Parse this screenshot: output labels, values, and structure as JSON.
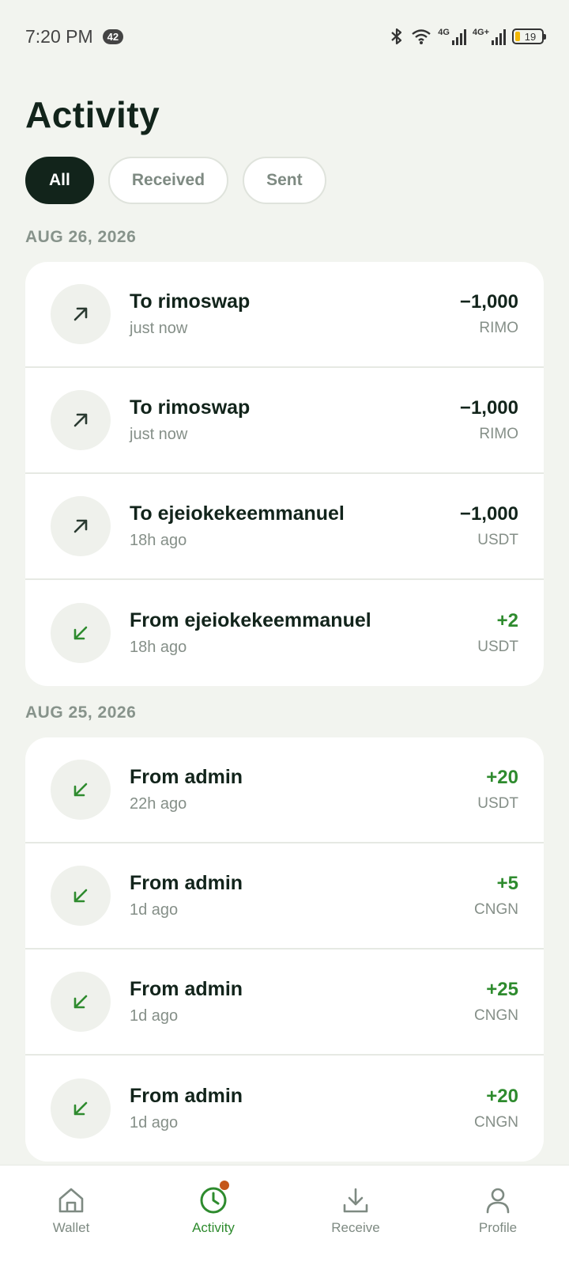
{
  "status_bar": {
    "time": "7:20 PM",
    "notification_count": "42",
    "network1": "4G",
    "network2": "4G+",
    "battery": "19"
  },
  "page": {
    "title": "Activity"
  },
  "filters": [
    {
      "label": "All",
      "active": true
    },
    {
      "label": "Received",
      "active": false
    },
    {
      "label": "Sent",
      "active": false
    }
  ],
  "groups": [
    {
      "date": "AUG 26, 2026",
      "items": [
        {
          "direction": "sent",
          "icon": "arrow-up-right-icon",
          "title": "To rimoswap",
          "time": "just now",
          "amount": "−1,000",
          "currency": "RIMO"
        },
        {
          "direction": "sent",
          "icon": "arrow-up-right-icon",
          "title": "To rimoswap",
          "time": "just now",
          "amount": "−1,000",
          "currency": "RIMO"
        },
        {
          "direction": "sent",
          "icon": "arrow-up-right-icon",
          "title": "To ejeiokekeemmanuel",
          "time": "18h ago",
          "amount": "−1,000",
          "currency": "USDT"
        },
        {
          "direction": "received",
          "icon": "arrow-down-left-icon",
          "title": "From ejeiokekeemmanuel",
          "time": "18h ago",
          "amount": "+2",
          "currency": "USDT"
        }
      ]
    },
    {
      "date": "AUG 25, 2026",
      "items": [
        {
          "direction": "received",
          "icon": "arrow-down-left-icon",
          "title": "From admin",
          "time": "22h ago",
          "amount": "+20",
          "currency": "USDT"
        },
        {
          "direction": "received",
          "icon": "arrow-down-left-icon",
          "title": "From admin",
          "time": "1d ago",
          "amount": "+5",
          "currency": "CNGN"
        },
        {
          "direction": "received",
          "icon": "arrow-down-left-icon",
          "title": "From admin",
          "time": "1d ago",
          "amount": "+25",
          "currency": "CNGN"
        },
        {
          "direction": "received",
          "icon": "arrow-down-left-icon",
          "title": "From admin",
          "time": "1d ago",
          "amount": "+20",
          "currency": "CNGN"
        }
      ]
    }
  ],
  "nav": [
    {
      "label": "Wallet",
      "icon": "home-icon",
      "active": false
    },
    {
      "label": "Activity",
      "icon": "clock-icon",
      "active": true
    },
    {
      "label": "Receive",
      "icon": "download-icon",
      "active": false
    },
    {
      "label": "Profile",
      "icon": "person-icon",
      "active": false
    }
  ],
  "colors": {
    "background": "#f2f4ef",
    "primary_dark": "#12241b",
    "positive": "#2e8b2e",
    "muted": "#858f88",
    "notification_dot": "#c4571a"
  }
}
